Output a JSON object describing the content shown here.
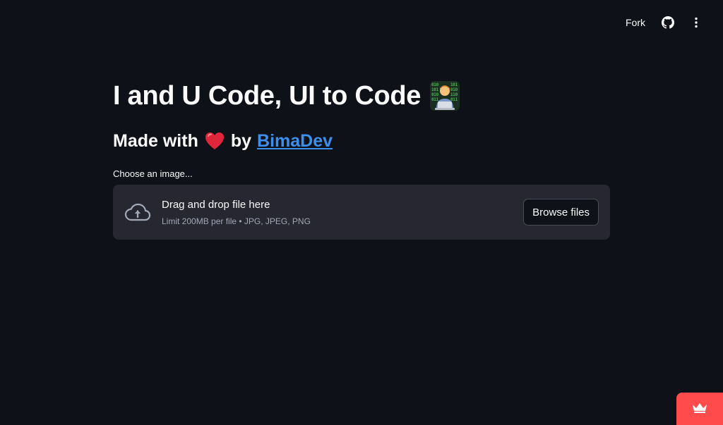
{
  "toolbar": {
    "fork_label": "Fork",
    "github_icon": "github-icon",
    "menu_icon": "vertical-dots-icon"
  },
  "main": {
    "title": "I and U Code, UI to Code",
    "title_emoji": "technologist-emoji",
    "subtitle_prefix": "Made with",
    "subtitle_heart": "red-heart-emoji",
    "subtitle_by": "by",
    "author_link": "BimaDev",
    "link_color": "#3d8fee"
  },
  "uploader": {
    "label": "Choose an image...",
    "drop_title": "Drag and drop file here",
    "drop_limit": "Limit 200MB per file • JPG, JPEG, PNG",
    "browse_label": "Browse files",
    "icon": "cloud-upload-icon"
  },
  "badge": {
    "icon": "crown-icon",
    "color": "#ff4b4b"
  },
  "colors": {
    "background": "#0e1117",
    "dropzone": "#262730",
    "text": "#fafafa"
  }
}
